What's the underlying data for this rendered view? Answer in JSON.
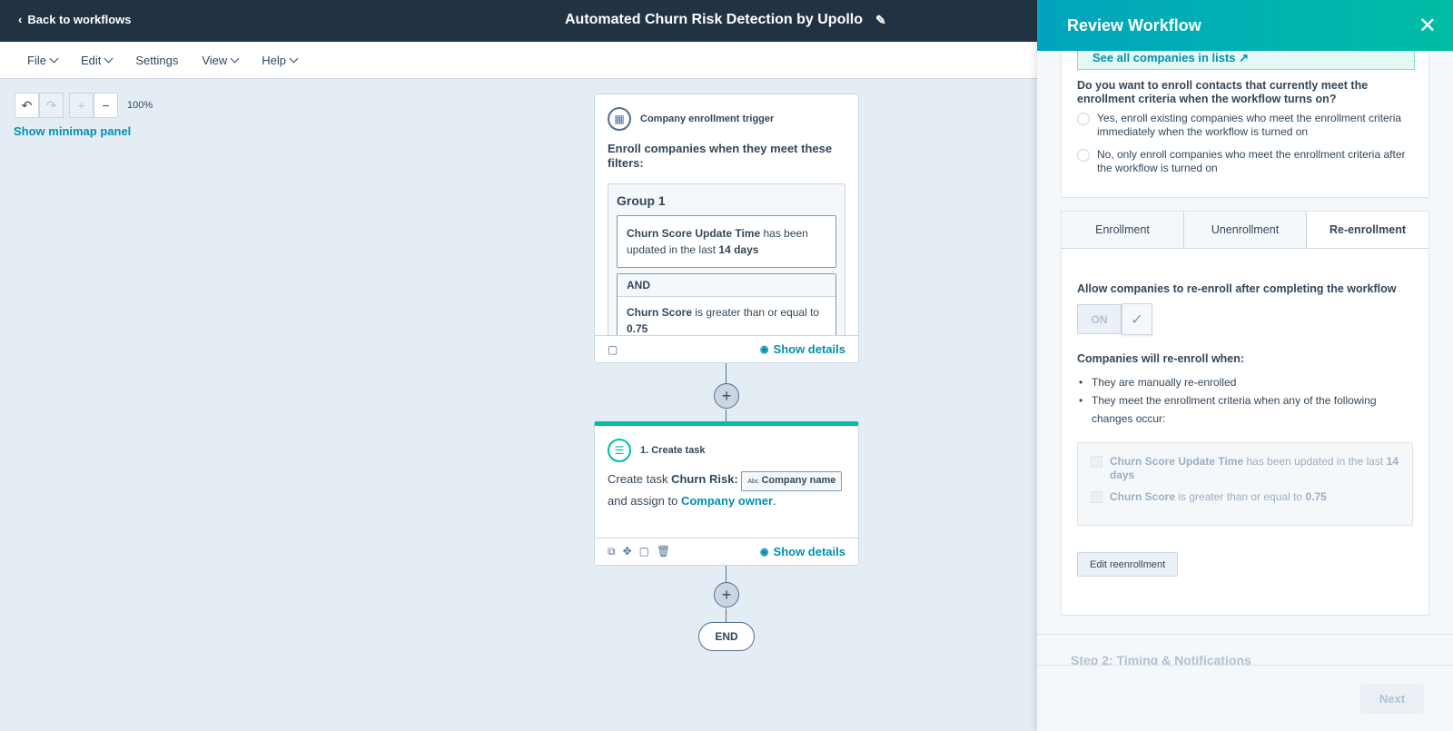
{
  "topbar": {
    "back_label": "Back to workflows",
    "title": "Automated Churn Risk Detection by Upollo"
  },
  "menubar": {
    "items": [
      {
        "label": "File",
        "dropdown": true
      },
      {
        "label": "Edit",
        "dropdown": true
      },
      {
        "label": "Settings",
        "dropdown": false
      },
      {
        "label": "View",
        "dropdown": true
      },
      {
        "label": "Help",
        "dropdown": true
      }
    ]
  },
  "canvas": {
    "zoom_level": "100%",
    "minimap_link": "Show minimap panel",
    "trigger_card": {
      "header": "Company enrollment trigger",
      "enroll_text": "Enroll companies when they meet these filters:",
      "group_title": "Group 1",
      "filter1": {
        "property": "Churn Score Update Time",
        "text": " has been updated in the last ",
        "value": "14 days"
      },
      "and_label": "AND",
      "filter2": {
        "property": "Churn Score",
        "text": " is greater than or equal to ",
        "value": "0.75"
      },
      "show_details": "Show details"
    },
    "task_card": {
      "header": "1. Create task",
      "line1_prefix": "Create task ",
      "task_name": "Churn Risk:",
      "chip_tag": "Abc",
      "chip_label": "Company name",
      "line2_prefix": "and assign to ",
      "assignee": "Company owner",
      "line2_suffix": ".",
      "show_details": "Show details"
    },
    "end_label": "END"
  },
  "panel": {
    "title": "Review Workflow",
    "see_all_link": "See all companies in lists",
    "question": "Do you want to enroll contacts that currently meet the enrollment criteria when the workflow turns on?",
    "radio_yes": "Yes, enroll existing companies who meet the enrollment criteria immediately when the workflow is turned on",
    "radio_no": "No, only enroll companies who meet the enrollment criteria after the workflow is turned on",
    "tabs": [
      "Enrollment",
      "Unenrollment",
      "Re-enrollment"
    ],
    "active_tab": "Re-enrollment",
    "reenroll_question": "Allow companies to re-enroll after completing the workflow",
    "toggle_label": "ON",
    "will_reenroll_heading": "Companies will re-enroll when:",
    "bullets": [
      "They are manually re-enrolled",
      "They meet the enrollment criteria when any of the following changes occur:"
    ],
    "criteria": [
      {
        "property": "Churn Score Update Time",
        "text": " has been updated in the last ",
        "value": "14 days"
      },
      {
        "property": "Churn Score",
        "text": " is greater than or equal to ",
        "value": "0.75"
      }
    ],
    "edit_button": "Edit reenrollment",
    "step2_label": "Step 2: Timing & Notifications",
    "next_button": "Next"
  },
  "colors": {
    "topbar": "#213343",
    "accent": "#0091ae",
    "teal": "#00bda5"
  }
}
